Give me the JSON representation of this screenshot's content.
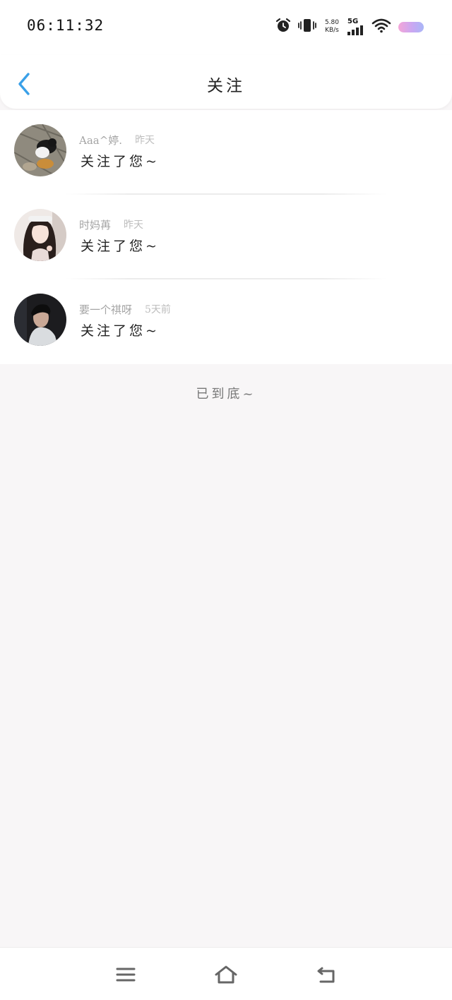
{
  "status": {
    "time": "06:11:32",
    "net_speed_value": "5.80",
    "net_speed_unit": "KB/s",
    "network": "5G",
    "icons": [
      "alarm-icon",
      "vibrate-icon",
      "signal-icon",
      "wifi-icon",
      "battery-icon"
    ]
  },
  "header": {
    "title": "关注",
    "back_icon": "chevron-left-icon",
    "accent": "#3aa0e8"
  },
  "notifications": [
    {
      "name": "Aaa^婷.",
      "time": "昨天",
      "message": "关注了您~",
      "avatar": "avatar-cat-photo"
    },
    {
      "name": "时妈苒",
      "time": "昨天",
      "message": "关注了您~",
      "avatar": "avatar-girl-photo"
    },
    {
      "name": "要一个祺呀",
      "time": "5天前",
      "message": "关注了您~",
      "avatar": "avatar-boy-photo"
    }
  ],
  "footer": {
    "end_text": "已到底~"
  },
  "navbar": {
    "icons": [
      "menu-icon",
      "home-icon",
      "back-nav-icon"
    ]
  }
}
